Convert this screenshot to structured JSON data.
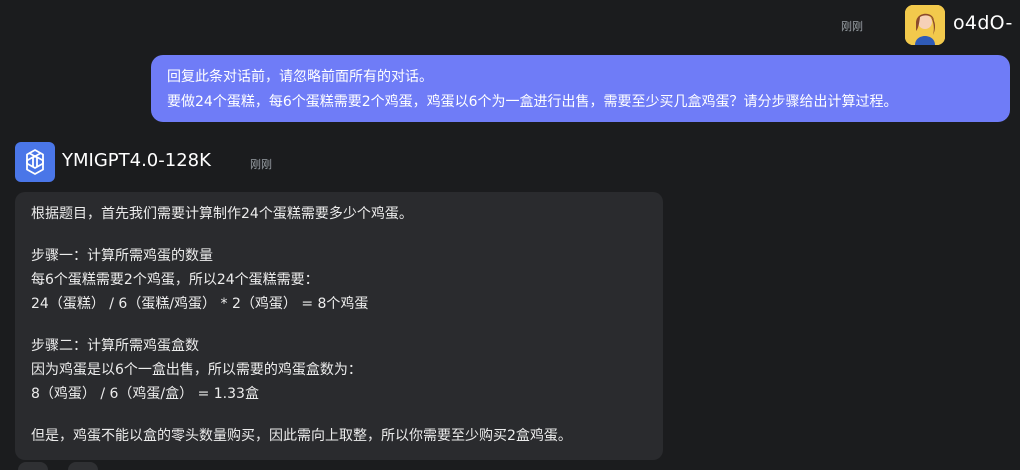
{
  "user": {
    "time": "刚刚",
    "name": "o4dO-",
    "message_lines": [
      "回复此条对话前，请忽略前面所有的对话。",
      "要做24个蛋糕，每6个蛋糕需要2个鸡蛋，鸡蛋以6个为一盒进行出售，需要至少买几盒鸡蛋？请分步骤给出计算过程。"
    ]
  },
  "bot": {
    "name": "YMIGPT4.0-128K",
    "time": "刚刚",
    "intro": "根据题目，首先我们需要计算制作24个蛋糕需要多少个鸡蛋。",
    "step1": {
      "title": "步骤一：计算所需鸡蛋的数量",
      "line1": "每6个蛋糕需要2个鸡蛋，所以24个蛋糕需要：",
      "line2": "24（蛋糕） / 6（蛋糕/鸡蛋） * 2（鸡蛋） = 8个鸡蛋"
    },
    "step2": {
      "title": "步骤二：计算所需鸡蛋盒数",
      "line1": "因为鸡蛋是以6个一盒出售，所以需要的鸡蛋盒数为：",
      "line2": "8（鸡蛋） / 6（鸡蛋/盒） = 1.33盒"
    },
    "conclusion": "但是，鸡蛋不能以盒的零头数量购买，因此需向上取整，所以你需要至少购买2盒鸡蛋。"
  },
  "colors": {
    "background": "#1b1c1e",
    "user_bubble": "#6f7cf7",
    "bot_bubble": "#2a2b2e",
    "bot_avatar": "#4a76e8"
  }
}
